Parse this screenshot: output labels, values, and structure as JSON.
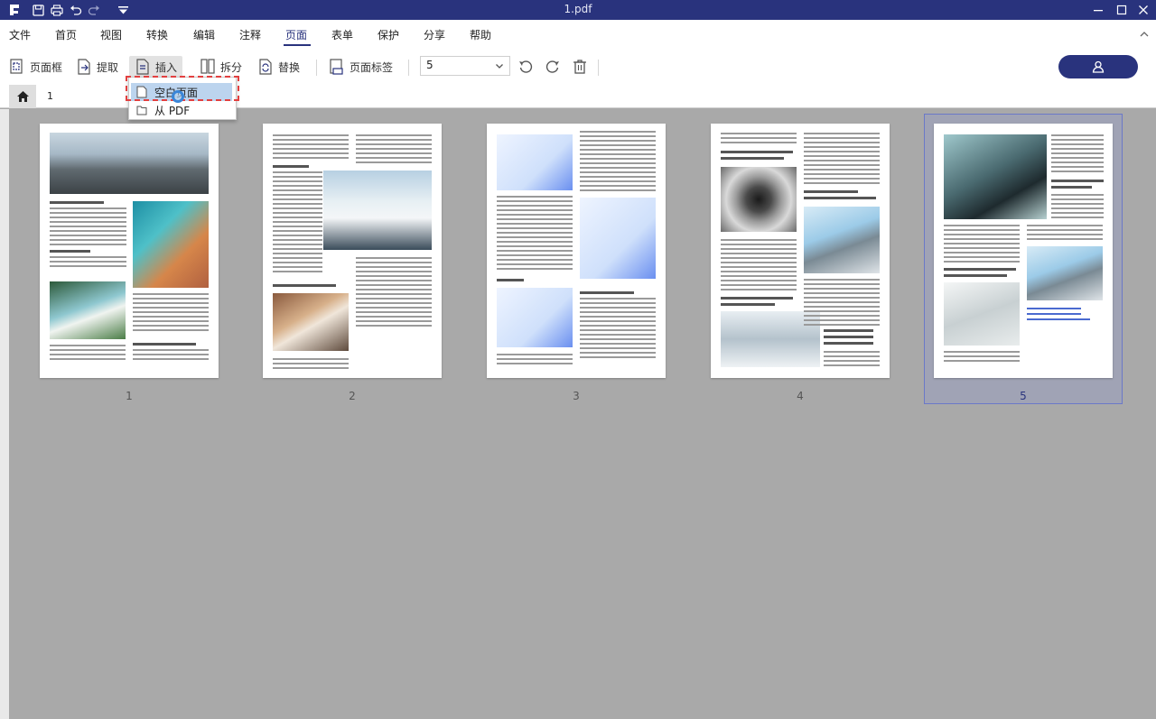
{
  "window": {
    "title": "1.pdf"
  },
  "menu": [
    "文件",
    "首页",
    "视图",
    "转换",
    "编辑",
    "注释",
    "页面",
    "表单",
    "保护",
    "分享",
    "帮助"
  ],
  "active_menu": "页面",
  "toolbar": {
    "page_box": "页面框",
    "extract": "提取",
    "insert": "插入",
    "split": "拆分",
    "replace": "替换",
    "page_label": "页面标签",
    "page_select_value": "5"
  },
  "tabs": {
    "current_page_tab": "1"
  },
  "insert_menu": {
    "items": [
      "空白页面",
      "从 PDF"
    ],
    "highlighted_index": 0
  },
  "thumbnails": [
    "1",
    "2",
    "3",
    "4",
    "5"
  ],
  "selected_page": "5",
  "colors": {
    "accent": "#29337d",
    "selection": "#6b79c8",
    "highlight_border": "#e24040"
  }
}
